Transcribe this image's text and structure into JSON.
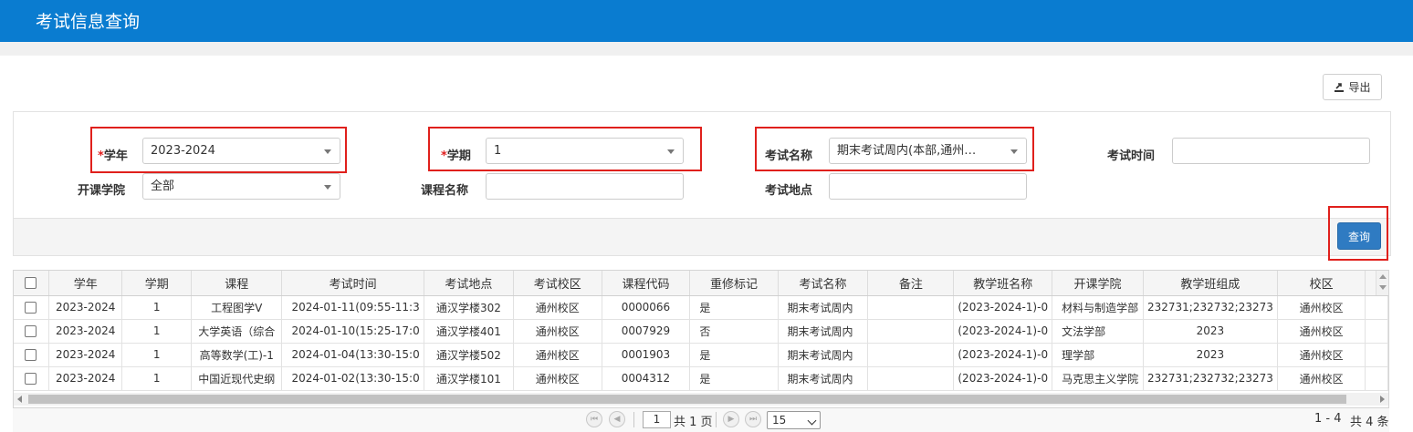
{
  "page": {
    "title": "考试信息查询"
  },
  "toolbar": {
    "export_label": "导出"
  },
  "filters": {
    "academic_year": {
      "label": "学年",
      "required_mark": "*",
      "value": "2023-2024"
    },
    "term": {
      "label": "学期",
      "required_mark": "*",
      "value": "1"
    },
    "exam_name": {
      "label": "考试名称",
      "value": "期末考试周内(本部,通州…"
    },
    "exam_time": {
      "label": "考试时间",
      "value": ""
    },
    "college": {
      "label": "开课学院",
      "value": "全部"
    },
    "course_name": {
      "label": "课程名称",
      "value": ""
    },
    "exam_location": {
      "label": "考试地点",
      "value": ""
    }
  },
  "actions": {
    "query_label": "查询"
  },
  "table": {
    "columns": [
      "学年",
      "学期",
      "课程",
      "考试时间",
      "考试地点",
      "考试校区",
      "课程代码",
      "重修标记",
      "考试名称",
      "备注",
      "教学班名称",
      "开课学院",
      "教学班组成",
      "校区"
    ],
    "rows": [
      [
        "2023-2024",
        "1",
        "工程图学Ⅴ",
        "2024-01-11(09:55-11:3",
        "通汉学楼302",
        "通州校区",
        "0000066",
        "是",
        "期末考试周内",
        "",
        "(2023-2024-1)-0",
        "材料与制造学部",
        "232731;232732;23273",
        "通州校区"
      ],
      [
        "2023-2024",
        "1",
        "大学英语（综合",
        "2024-01-10(15:25-17:0",
        "通汉学楼401",
        "通州校区",
        "0007929",
        "否",
        "期末考试周内",
        "",
        "(2023-2024-1)-0",
        "文法学部",
        "2023",
        "通州校区"
      ],
      [
        "2023-2024",
        "1",
        "高等数学(工)-1",
        "2024-01-04(13:30-15:0",
        "通汉学楼502",
        "通州校区",
        "0001903",
        "是",
        "期末考试周内",
        "",
        "(2023-2024-1)-0",
        "理学部",
        "2023",
        "通州校区"
      ],
      [
        "2023-2024",
        "1",
        "中国近现代史纲",
        "2024-01-02(13:30-15:0",
        "通汉学楼101",
        "通州校区",
        "0004312",
        "是",
        "期末考试周内",
        "",
        "(2023-2024-1)-0",
        "马克思主义学院",
        "232731;232732;23273",
        "通州校区"
      ]
    ]
  },
  "pager": {
    "current_page": "1",
    "total_pages_text": "共 1 页",
    "page_size": "15",
    "range_text": "1 - 4",
    "total_text": "共 4 条"
  },
  "colors": {
    "header": "#0a7cd0",
    "query_button": "#2f7bc2",
    "highlight_box": "#e0201c"
  }
}
